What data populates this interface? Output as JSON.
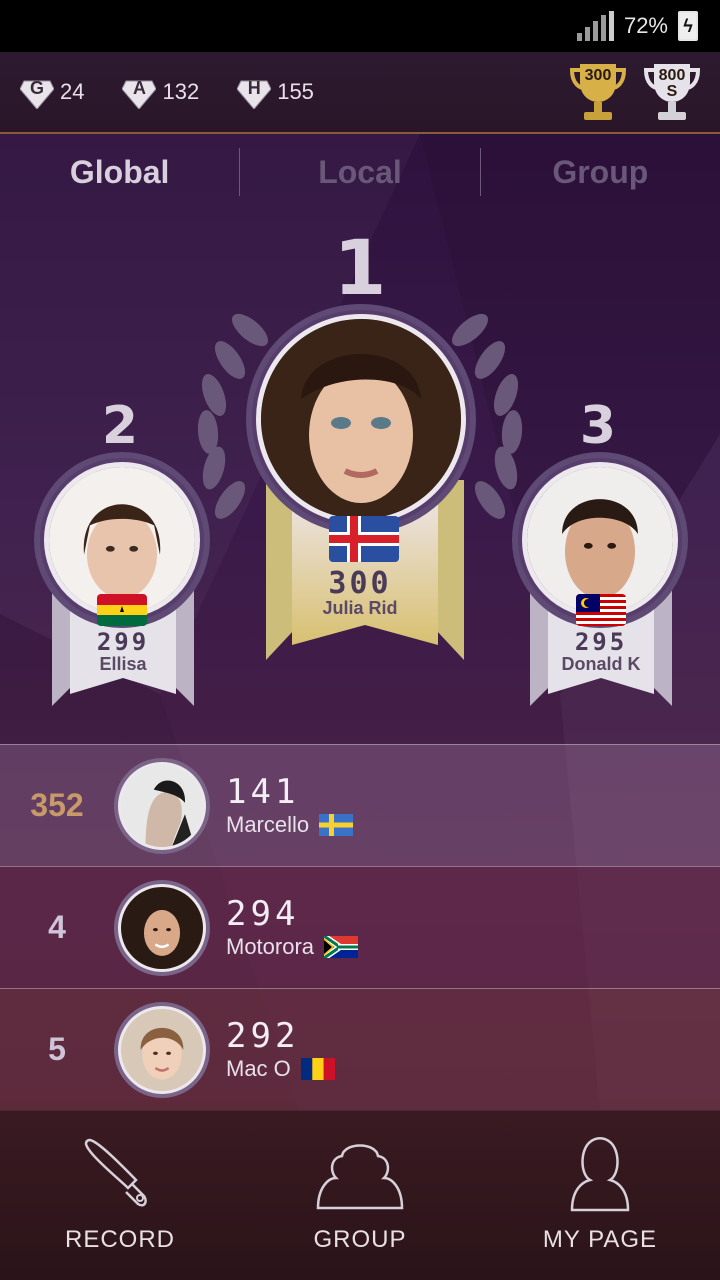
{
  "status_bar": {
    "battery_percent": "72%",
    "signal_icon": "signal-icon",
    "battery_icon": "battery-charging-icon"
  },
  "currency": {
    "items": [
      {
        "icon": "G",
        "value": "24"
      },
      {
        "icon": "A",
        "value": "132"
      },
      {
        "icon": "H",
        "value": "155"
      }
    ]
  },
  "trophies": {
    "gold_label": "300",
    "silver_label": "800\nS"
  },
  "tabs": [
    "Global",
    "Local",
    "Group"
  ],
  "active_tab": "Global",
  "podium": {
    "first": {
      "rank": "1",
      "score": "300",
      "name": "Julia Rid",
      "flag": "Iceland"
    },
    "second": {
      "rank": "2",
      "score": "299",
      "name": "Ellisa",
      "flag": "Ghana"
    },
    "third": {
      "rank": "3",
      "score": "295",
      "name": "Donald K",
      "flag": "Malaysia"
    }
  },
  "rows": [
    {
      "rank": "352",
      "score": "141",
      "name": "Marcello",
      "flag": "Sweden"
    },
    {
      "rank": "4",
      "score": "294",
      "name": "Motorora",
      "flag": "South Africa"
    },
    {
      "rank": "5",
      "score": "292",
      "name": "Mac O",
      "flag": "Romania"
    }
  ],
  "nav": {
    "record": "RECORD",
    "group": "GROUP",
    "my_page": "MY PAGE"
  },
  "colors": {
    "gold": "#c9a13a",
    "silver": "#d4d0d8",
    "accent_rank": "#c89a6a"
  }
}
